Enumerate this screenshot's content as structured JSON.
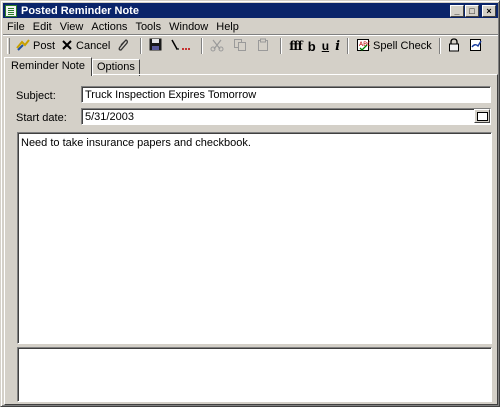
{
  "window": {
    "title": "Posted Reminder Note",
    "buttons": {
      "minimize": "_",
      "maximize": "□",
      "close": "×"
    }
  },
  "menu": [
    "File",
    "Edit",
    "View",
    "Actions",
    "Tools",
    "Window",
    "Help"
  ],
  "toolbar": {
    "post_label": "Post",
    "cancel_label": "Cancel",
    "spell_check_label": "Spell Check",
    "font_label": "fff",
    "bold_label": "b",
    "underline_label": "u",
    "italic_label": "i"
  },
  "tabs": [
    "Reminder Note",
    "Options"
  ],
  "form": {
    "subject_label": "Subject:",
    "subject_value": "Truck Inspection Expires Tomorrow",
    "start_date_label": "Start date:",
    "start_date_value": "5/31/2003",
    "body_text": "Need to take insurance papers and checkbook."
  },
  "icons": {
    "post": "post-icon",
    "cancel": "cancel-icon",
    "attach": "paperclip-icon",
    "save": "save-icon",
    "address": "address-book-icon",
    "cut": "cut-icon",
    "copy": "copy-icon",
    "paste": "paste-icon",
    "spell": "spell-check-icon",
    "lock": "lock-icon",
    "sign": "sign-icon",
    "calendar": "calendar-icon"
  }
}
